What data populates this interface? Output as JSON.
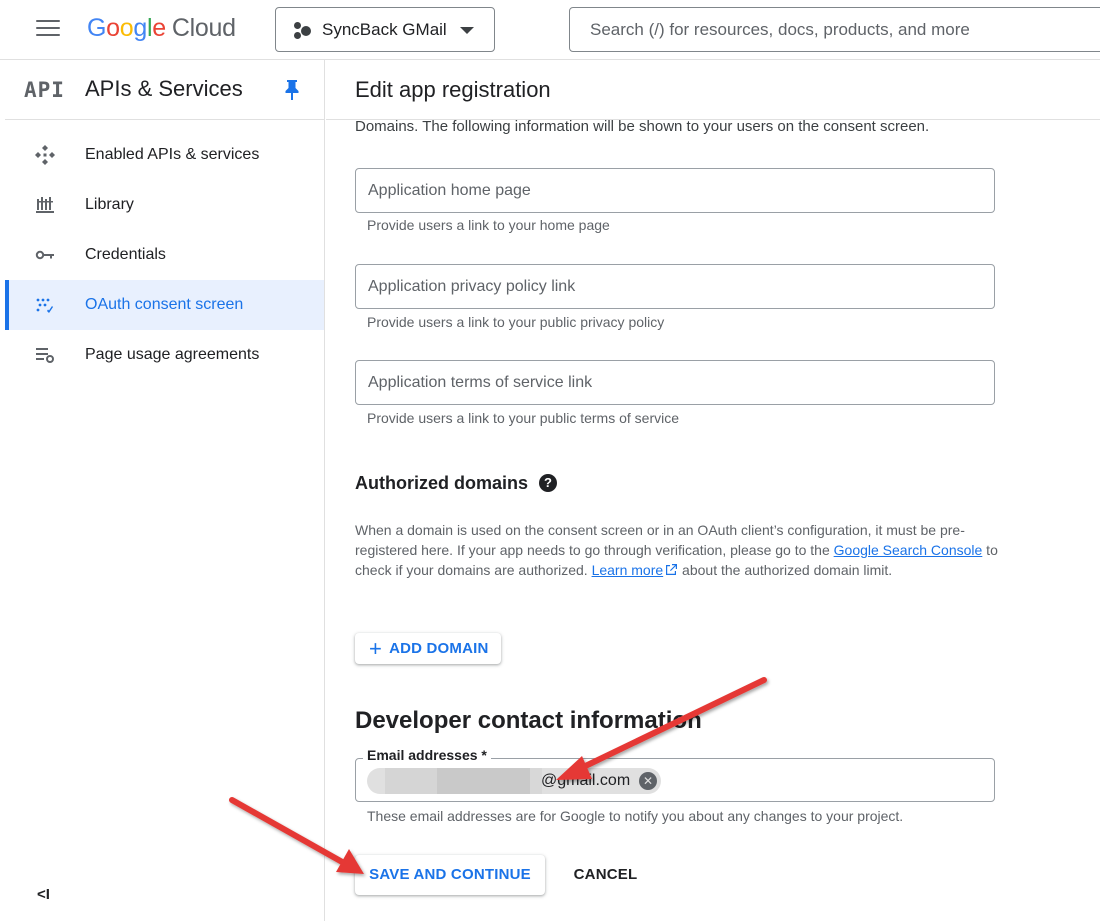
{
  "topbar": {
    "logo": {
      "g1": "G",
      "g2": "o",
      "g3": "o",
      "g4": "g",
      "g5": "l",
      "g6": "e",
      "product": "Cloud"
    },
    "project_name": "SyncBack GMail",
    "search_placeholder": "Search (/) for resources, docs, products, and more"
  },
  "sidebar": {
    "logo_text": "API",
    "title": "APIs & Services",
    "items": [
      {
        "label": "Enabled APIs & services",
        "icon": "enabled-apis-icon"
      },
      {
        "label": "Library",
        "icon": "library-icon"
      },
      {
        "label": "Credentials",
        "icon": "key-icon"
      },
      {
        "label": "OAuth consent screen",
        "icon": "oauth-consent-icon",
        "active": true
      },
      {
        "label": "Page usage agreements",
        "icon": "page-usage-icon"
      }
    ],
    "collapse_label": "<I"
  },
  "main": {
    "title": "Edit app registration",
    "intro": "Domains. The following information will be shown to your users on the consent screen.",
    "fields": [
      {
        "placeholder": "Application home page",
        "hint": "Provide users a link to your home page"
      },
      {
        "placeholder": "Application privacy policy link",
        "hint": "Provide users a link to your public privacy policy"
      },
      {
        "placeholder": "Application terms of service link",
        "hint": "Provide users a link to your public terms of service"
      }
    ],
    "authorized_domains": {
      "title": "Authorized domains",
      "help": "?",
      "desc_part1": "When a domain is used on the consent screen or in an OAuth client’s configuration, it must be pre-registered here. If your app needs to go through verification, please go to the ",
      "link_search_console": "Google Search Console",
      "desc_part2": " to check if your domains are authorized. ",
      "link_learn_more": "Learn more",
      "desc_part3": " about the authorized domain limit.",
      "add_domain_label": "ADD DOMAIN",
      "plus": "+"
    },
    "developer_contact": {
      "title": "Developer contact information",
      "email_label": "Email addresses *",
      "email_chip_text": "@gmail.com",
      "remove_glyph": "✕",
      "hint": "These email addresses are for Google to notify you about any changes to your project."
    },
    "save_label": "SAVE AND CONTINUE",
    "cancel_label": "CANCEL"
  },
  "colors": {
    "accent": "#1a73e8",
    "arrow": "#e53935"
  }
}
